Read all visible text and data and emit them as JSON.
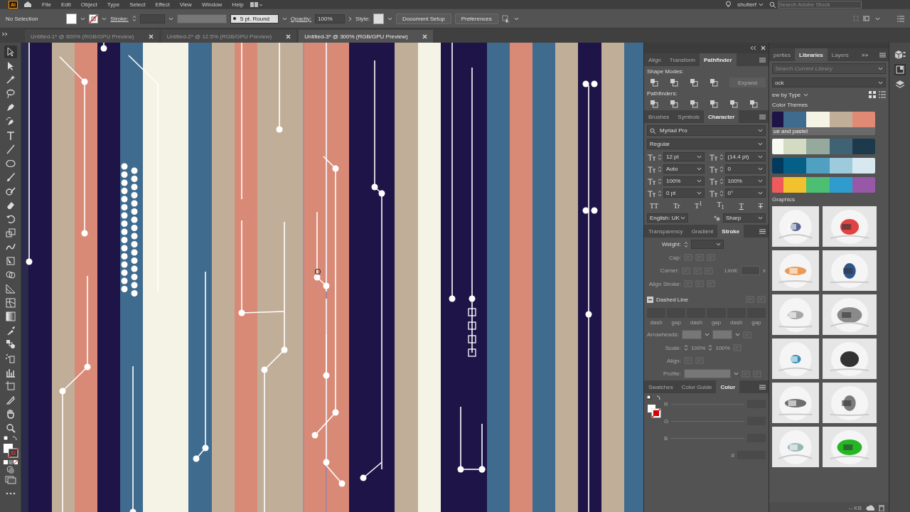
{
  "menu_bar": {
    "logo": "Ai",
    "items": [
      "File",
      "Edit",
      "Object",
      "Type",
      "Select",
      "Effect",
      "View",
      "Window",
      "Help"
    ],
    "workspace": "shutterf",
    "stock_search": {
      "placeholder": "Search Adobe Stock"
    }
  },
  "control_bar": {
    "selection": "No Selection",
    "stroke_label": "Stroke:",
    "brush": "5 pt. Round",
    "opacity_label": "Opacity:",
    "opacity": "100%",
    "style_label": "Style:",
    "buttons": [
      "Document Setup",
      "Preferences"
    ]
  },
  "doc_tabs": [
    {
      "label": "Untitled-1* @ 600% (RGB/GPU Preview)",
      "selected": false
    },
    {
      "label": "Untitled-2* @ 12.5% (RGB/GPU Preview)",
      "selected": false
    },
    {
      "label": "Untitled-3* @ 300% (RGB/GPU Preview)",
      "selected": true
    }
  ],
  "pathfinder_panel": {
    "tabs": [
      {
        "label": "Align",
        "selected": false
      },
      {
        "label": "Transform",
        "selected": false
      },
      {
        "label": "Pathfinder",
        "selected": true
      }
    ],
    "shape_modes_label": "Shape Modes:",
    "expand": "Expand",
    "pathfinders_label": "Pathfinders:"
  },
  "character_panel": {
    "tabs": [
      {
        "label": "Brushes",
        "selected": false
      },
      {
        "label": "Symbols",
        "selected": false
      },
      {
        "label": "Character",
        "selected": true
      }
    ],
    "font": "Myriad Pro",
    "style": "Regular",
    "fields": [
      "12 pt",
      "(14.4 pt)",
      "Auto",
      "0",
      "100%",
      "100%",
      "0 pt",
      "0°"
    ],
    "type_buttons": [
      {
        "label": "TT",
        "kind": "plain"
      },
      {
        "label": "Tr",
        "kind": "plain"
      },
      {
        "label": "T$^{1}$",
        "kind": "plain"
      },
      {
        "label": "T$_{1}$",
        "kind": "plain"
      },
      {
        "label": "T",
        "kind": "underline"
      },
      {
        "label": "T",
        "kind": "strike"
      }
    ],
    "language": "English: UK",
    "antialias": "Sharp"
  },
  "stroke_panel": {
    "tabs": [
      {
        "label": "Transparency",
        "selected": false
      },
      {
        "label": "Gradient",
        "selected": false
      },
      {
        "label": "Stroke",
        "selected": true
      }
    ],
    "weight_label": "Weight:",
    "cap_label": "Cap:",
    "corner_label": "Corner:",
    "limit_label": "Limit:",
    "limit_unit": "x",
    "align_label": "Align Stroke:",
    "dashed_label": "Dashed Line",
    "dash_labels": [
      "dash",
      "gap",
      "dash",
      "gap",
      "dash",
      "gap"
    ],
    "arrowheads_label": "Arrowheads:",
    "scale_label": "Scale:",
    "scales": [
      "100%",
      "100%"
    ],
    "arrow_align_label": "Align:",
    "profile_label": "Profile:"
  },
  "color_panel": {
    "tabs": [
      {
        "label": "Swatches",
        "selected": false
      },
      {
        "label": "Color Guide",
        "selected": false
      },
      {
        "label": "Color",
        "selected": true
      }
    ],
    "channels": [
      "R",
      "G",
      "B"
    ],
    "hex_label": "#"
  },
  "libraries_panel": {
    "tabs": [
      {
        "label": "perties",
        "selected": false
      },
      {
        "label": "Libraries",
        "selected": true
      },
      {
        "label": "Layers",
        "selected": false
      }
    ],
    "more": ">>",
    "search": {
      "placeholder": "Search Current Library"
    },
    "library": "ock",
    "view": "ew by Type",
    "themes_label": "Color Themes",
    "themes": [
      {
        "name": "ue and pastel",
        "swatches": [
          {
            "color": "#1e1447"
          },
          {
            "color": "#3f6b8e"
          },
          {
            "color": "#f4f3e6"
          },
          {
            "color": "#c1ae98"
          },
          {
            "color": "#e08a76"
          }
        ]
      },
      {
        "swatches": [
          {
            "color": "#f6faf0"
          },
          {
            "color": "#d3dcc3"
          },
          {
            "color": "#95aa9c"
          },
          {
            "color": "#3f6275"
          },
          {
            "color": "#1d3a4c"
          }
        ]
      },
      {
        "swatches": [
          {
            "color": "#013a5c"
          },
          {
            "color": "#055f86"
          },
          {
            "color": "#4fa0c1"
          },
          {
            "color": "#9ecbdc"
          },
          {
            "color": "#d8e8f0"
          }
        ]
      },
      {
        "swatches": [
          {
            "color": "#f05a5a"
          },
          {
            "color": "#f2c12e"
          },
          {
            "color": "#4cbf72"
          },
          {
            "color": "#2e9ccc"
          },
          {
            "color": "#9858a8"
          }
        ]
      }
    ],
    "graphics_label": "Graphics",
    "size": "-- KB"
  }
}
